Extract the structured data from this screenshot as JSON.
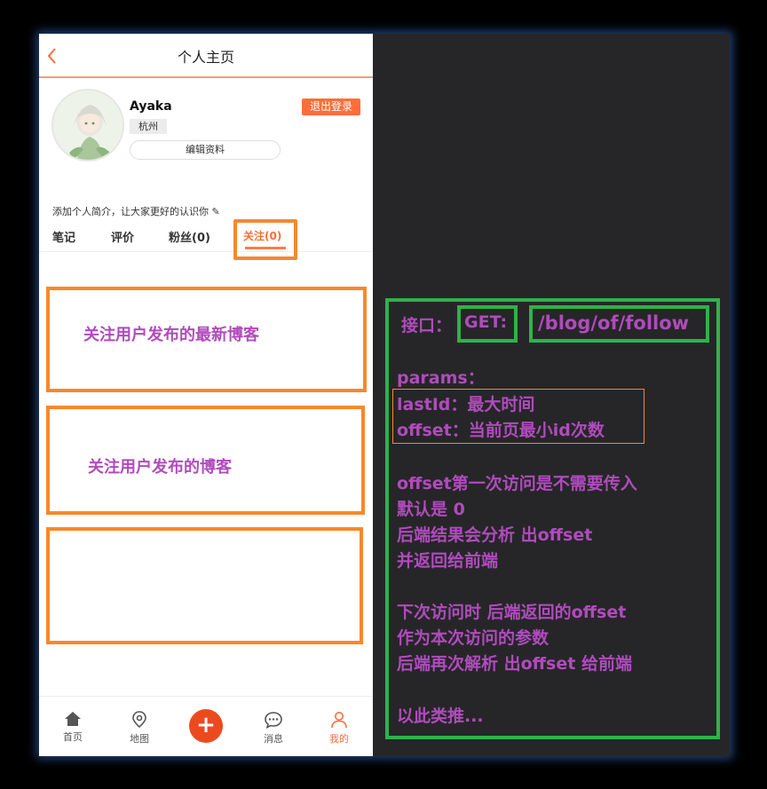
{
  "header": {
    "title": "个人主页"
  },
  "profile": {
    "username": "Ayaka",
    "city": "杭州",
    "logout_label": "退出登录",
    "edit_label": "编辑资料",
    "intro": "添加个人简介，让大家更好的认识你 ✎"
  },
  "tabs": [
    {
      "label": "笔记"
    },
    {
      "label": "评价"
    },
    {
      "label": "粉丝(0)"
    },
    {
      "label": "关注(0)"
    }
  ],
  "annotations": {
    "box1": "关注用户发布的最新博客",
    "box2": "关注用户发布的博客",
    "api_prefix": "接口：",
    "api_method": "GET:",
    "api_path": "/blog/of/follow",
    "params_title": "params：",
    "param_lastid": "lastId：最大时间",
    "param_offset": "offset：当前页最小id次数",
    "note1": "offset第一次访问是不需要传入",
    "note2": "默认是 0",
    "note3": "后端结果会分析 出offset",
    "note4": "并返回给前端",
    "note5": "下次访问时 后端返回的offset",
    "note6": "作为本次访问的参数",
    "note7": "后端再次解析 出offset 给前端",
    "note8": "以此类推..."
  },
  "bottom_nav": [
    {
      "label": "首页",
      "icon": "home-icon"
    },
    {
      "label": "地图",
      "icon": "map-pin-icon"
    },
    {
      "label": "+",
      "icon": "plus-icon"
    },
    {
      "label": "消息",
      "icon": "chat-icon"
    },
    {
      "label": "我的",
      "icon": "user-icon"
    }
  ],
  "colors": {
    "accent": "#ff6d3a",
    "annotation_orange": "#f7882c",
    "annotation_green": "#2fb24a",
    "annotation_text": "#b04bbd"
  }
}
